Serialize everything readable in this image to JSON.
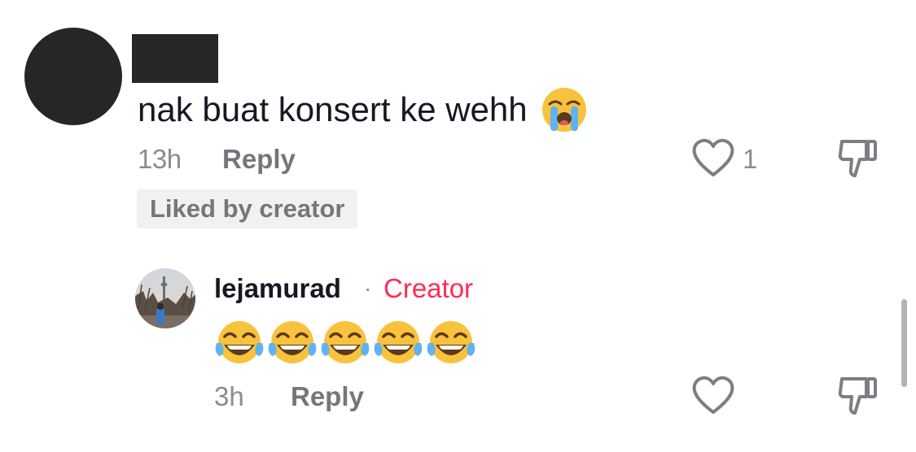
{
  "comment": {
    "avatar_icon": "avatar",
    "text": "nak buat konsert ke wehh",
    "emoji_icon": "loudly-crying-face-emoji",
    "time": "13h",
    "reply_label": "Reply",
    "like_icon": "heart-outline-icon",
    "like_count": "1",
    "dislike_icon": "thumbs-down-icon",
    "liked_by_creator": "Liked by creator"
  },
  "reply": {
    "username": "lejamurad",
    "separator": "·",
    "badge": "Creator",
    "emoji_icon": "face-with-tears-of-joy-emoji",
    "emoji_count": 5,
    "time": "3h",
    "reply_label": "Reply",
    "like_icon": "heart-outline-icon",
    "dislike_icon": "thumbs-down-icon"
  },
  "colors": {
    "text_primary": "#161823",
    "text_secondary": "#8a8b91",
    "creator_accent": "#fe2c55",
    "chip_background": "#f1f1f2"
  }
}
